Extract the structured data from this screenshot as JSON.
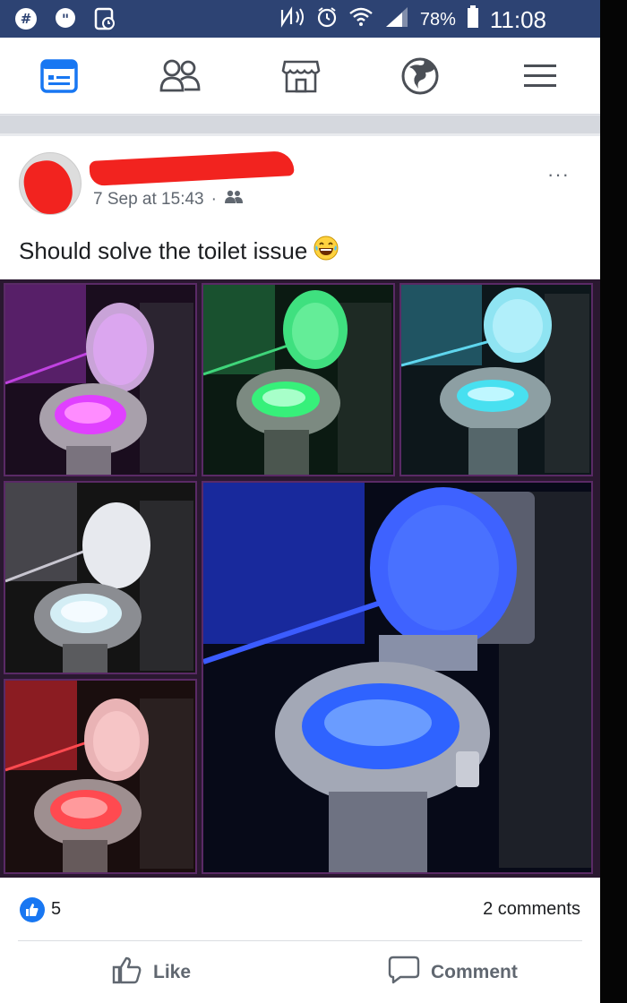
{
  "status_bar": {
    "battery_percent": "78%",
    "time": "11:08"
  },
  "nav": {
    "items": [
      {
        "icon": "news-feed-icon",
        "active": true
      },
      {
        "icon": "friends-icon",
        "active": false
      },
      {
        "icon": "marketplace-icon",
        "active": false
      },
      {
        "icon": "notifications-globe-icon",
        "active": false
      },
      {
        "icon": "menu-icon",
        "active": false
      }
    ]
  },
  "post": {
    "timestamp": "7 Sep at 15:43",
    "separator": "·",
    "text": "Should solve the toilet issue",
    "emoji": "😂",
    "more_label": "···",
    "photos": [
      {
        "glow": "#e040ff"
      },
      {
        "glow": "#37f07a"
      },
      {
        "glow": "#48e0f0"
      },
      {
        "glow": "#e8f4ff"
      },
      {
        "glow": "#ff4a50"
      },
      {
        "glow": "#2f63ff"
      }
    ],
    "like_count": "5",
    "comments_count": "2 comments",
    "like_label": "Like",
    "comment_label": "Comment"
  },
  "colors": {
    "status_bar": "#2d4373",
    "accent": "#1877f2",
    "redaction": "#f2231f"
  }
}
